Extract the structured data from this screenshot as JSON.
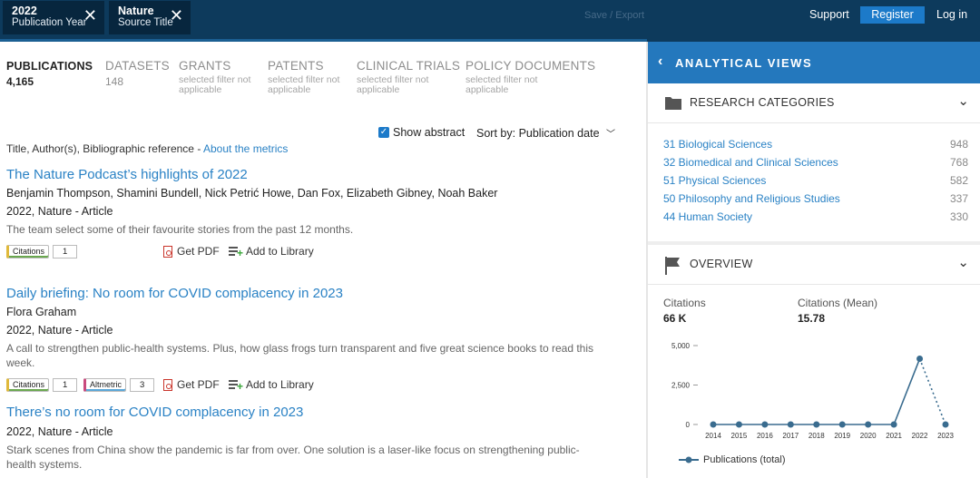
{
  "filters": [
    {
      "value": "2022",
      "label": "Publication Year"
    },
    {
      "value": "Nature",
      "label": "Source Title"
    }
  ],
  "header": {
    "save_export": "Save / Export",
    "support": "Support",
    "register": "Register",
    "login": "Log in"
  },
  "tabs": [
    {
      "name": "PUBLICATIONS",
      "count": "4,165",
      "note": ""
    },
    {
      "name": "DATASETS",
      "count": "148",
      "note": ""
    },
    {
      "name": "GRANTS",
      "count": "",
      "note": "selected filter not applicable"
    },
    {
      "name": "PATENTS",
      "count": "",
      "note": "selected filter not applicable"
    },
    {
      "name": "CLINICAL TRIALS",
      "count": "",
      "note": "selected filter not applicable"
    },
    {
      "name": "POLICY DOCUMENTS",
      "count": "",
      "note": "selected filter not applicable"
    }
  ],
  "controls": {
    "show_abstract": "Show abstract",
    "sort_label": "Sort by:",
    "sort_value": "Publication date"
  },
  "list_header": {
    "text": "Title, Author(s), Bibliographic reference - ",
    "link": "About the metrics"
  },
  "publications": [
    {
      "title": "The Nature Podcast’s highlights of 2022",
      "authors": "Benjamin Thompson, Shamini Bundell, Nick Petrić Howe, Dan Fox, Elizabeth Gibney, Noah Baker",
      "meta": "2022, Nature - Article",
      "abstract": "The team select some of their favourite stories from the past 12 months.",
      "citations_label": "Citations",
      "citations": "1",
      "altmetric_label": "",
      "altmetric": "",
      "pdf": "Get PDF",
      "library": "Add to Library"
    },
    {
      "title": "Daily briefing: No room for COVID complacency in 2023",
      "authors": "Flora Graham",
      "meta": "2022, Nature - Article",
      "abstract": "A call to strengthen public-health systems. Plus, how glass frogs turn transparent and five great science books to read this week.",
      "citations_label": "Citations",
      "citations": "1",
      "altmetric_label": "Altmetric",
      "altmetric": "3",
      "pdf": "Get PDF",
      "library": "Add to Library"
    },
    {
      "title": "There’s no room for COVID complacency in 2023",
      "authors": "",
      "meta": "2022, Nature - Article",
      "abstract": "Stark scenes from China show the pandemic is far from over. One solution is a laser-like focus on strengthening public-health systems."
    }
  ],
  "sidebar": {
    "title": "ANALYTICAL VIEWS",
    "research_categories": {
      "title": "RESEARCH CATEGORIES",
      "items": [
        {
          "label": "31 Biological Sciences",
          "count": "948"
        },
        {
          "label": "32 Biomedical and Clinical Sciences",
          "count": "768"
        },
        {
          "label": "51 Physical Sciences",
          "count": "582"
        },
        {
          "label": "50 Philosophy and Religious Studies",
          "count": "337"
        },
        {
          "label": "44 Human Society",
          "count": "330"
        }
      ]
    },
    "overview": {
      "title": "OVERVIEW",
      "citations_label": "Citations",
      "citations_value": "66 K",
      "mean_label": "Citations (Mean)",
      "mean_value": "15.78"
    }
  },
  "chart_data": {
    "type": "line",
    "x": [
      "2014",
      "2015",
      "2016",
      "2017",
      "2018",
      "2019",
      "2020",
      "2021",
      "2022",
      "2023"
    ],
    "y_ticks": [
      "0",
      "2,500",
      "5,000"
    ],
    "ylim": [
      0,
      5000
    ],
    "series": [
      {
        "name": "Publications (total)",
        "values": [
          0,
          0,
          0,
          0,
          0,
          0,
          0,
          0,
          4165,
          0
        ]
      }
    ],
    "last_segment_dotted": true,
    "color": "#3a6c8f"
  }
}
